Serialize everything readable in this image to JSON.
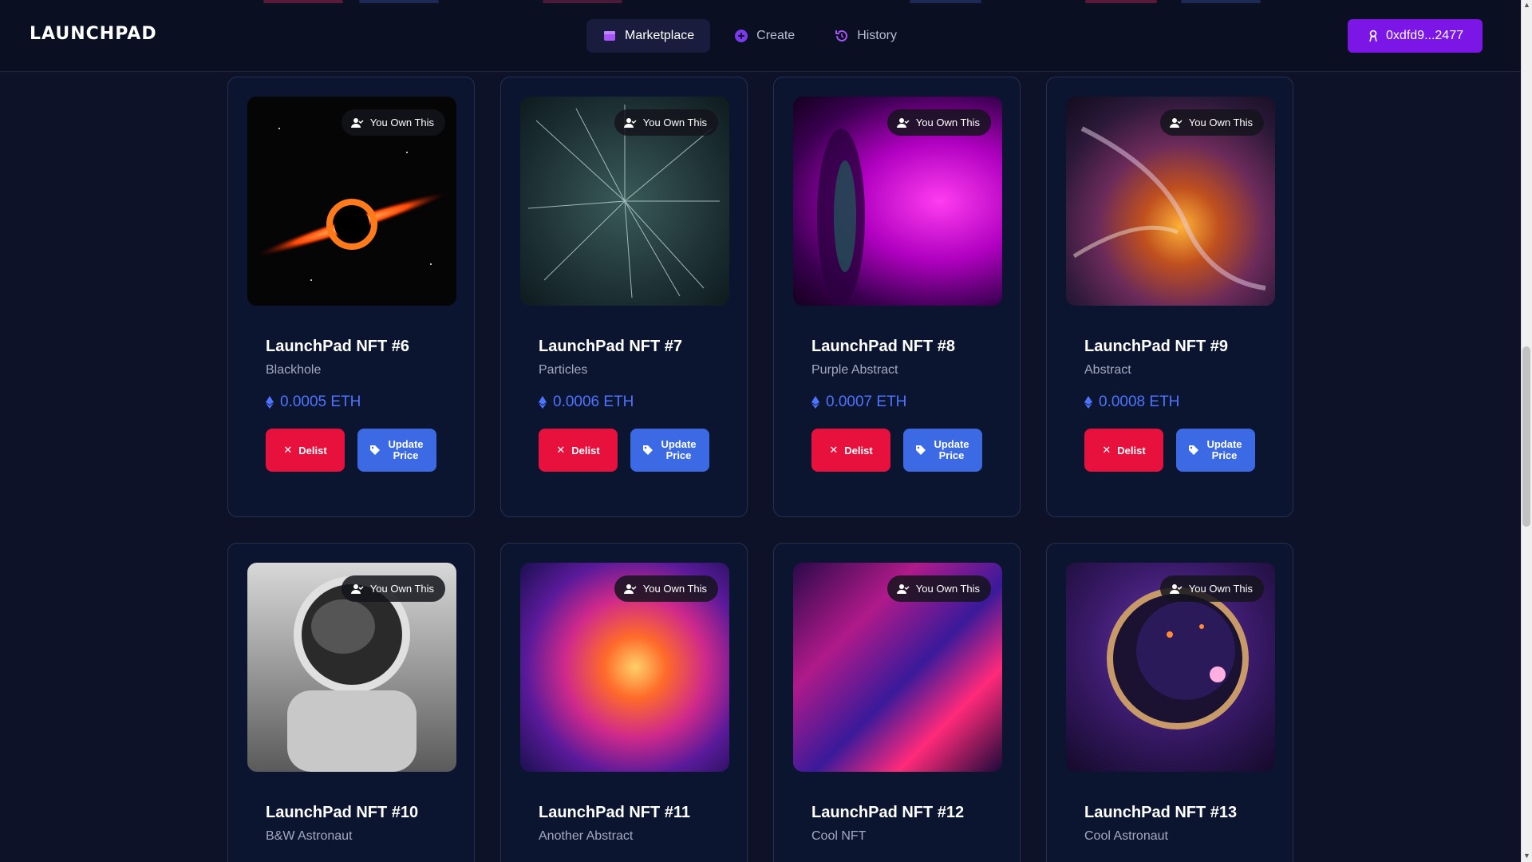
{
  "header": {
    "logo": "LAUNCHPAD",
    "nav": [
      {
        "label": "Marketplace",
        "icon": "store-icon",
        "active": true
      },
      {
        "label": "Create",
        "icon": "plus-circle-icon",
        "active": false
      },
      {
        "label": "History",
        "icon": "history-icon",
        "active": false
      }
    ],
    "wallet": {
      "label": "0xdfd9...2477",
      "icon": "user-badge-icon"
    }
  },
  "colors": {
    "accent": "#7b16e6",
    "delist": "#e8113d",
    "update": "#3b6ae4",
    "price": "#4d74ff"
  },
  "badge_label": "You Own This",
  "cards": [
    {
      "title": "LaunchPad NFT #6",
      "subtitle": "Blackhole",
      "price": "0.0005 ETH",
      "delist": "Delist",
      "update": "Update Price"
    },
    {
      "title": "LaunchPad NFT #7",
      "subtitle": "Particles",
      "price": "0.0006 ETH",
      "delist": "Delist",
      "update": "Update Price"
    },
    {
      "title": "LaunchPad NFT #8",
      "subtitle": "Purple Abstract",
      "price": "0.0007 ETH",
      "delist": "Delist",
      "update": "Update Price"
    },
    {
      "title": "LaunchPad NFT #9",
      "subtitle": "Abstract",
      "price": "0.0008 ETH",
      "delist": "Delist",
      "update": "Update Price"
    },
    {
      "title": "LaunchPad NFT #10",
      "subtitle": "B&W Astronaut"
    },
    {
      "title": "LaunchPad NFT #11",
      "subtitle": "Another Abstract"
    },
    {
      "title": "LaunchPad NFT #12",
      "subtitle": "Cool NFT"
    },
    {
      "title": "LaunchPad NFT #13",
      "subtitle": "Cool Astronaut"
    }
  ]
}
